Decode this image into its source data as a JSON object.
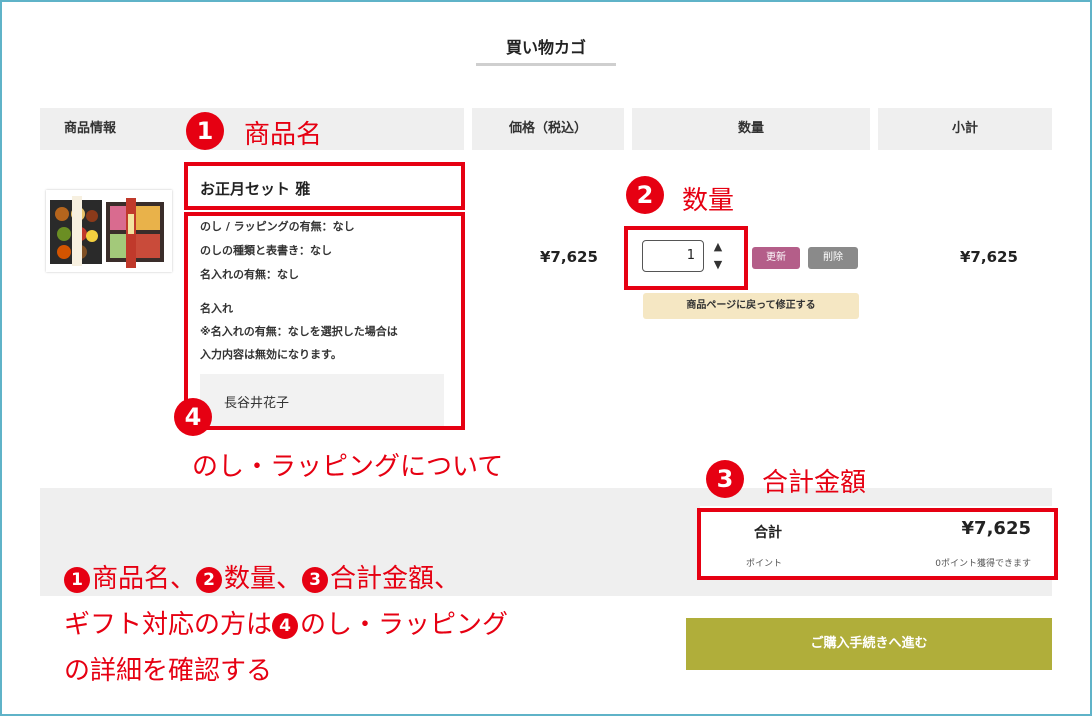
{
  "header": {
    "title": "買い物カゴ"
  },
  "table_headers": [
    "商品情報",
    "価格（税込）",
    "数量",
    "小計"
  ],
  "item": {
    "name": "お正月セット 雅",
    "options": [
      "のし / ラッピングの有無：なし",
      "のしの種類と表書き：なし",
      "名入れの有無：なし",
      "名入れ",
      "※名入れの有無：なしを選択した場合は",
      "入力内容は無効になります。"
    ],
    "engraving_name": "長谷井花子",
    "price": "¥7,625",
    "quantity": "1",
    "update_label": "更新",
    "delete_label": "削除",
    "return_label": "商品ページに戻って修正する",
    "subtotal": "¥7,625"
  },
  "summary": {
    "total_label": "合計",
    "total_amount": "¥7,625",
    "point_label": "ポイント",
    "point_note": "0ポイント獲得できます"
  },
  "checkout_label": "ご購入手続きへ進む",
  "annotations": {
    "numbers": [
      "1",
      "2",
      "3",
      "4"
    ],
    "labels": [
      "商品名",
      "数量",
      "合計金額",
      "のし・ラッピングについて"
    ],
    "highlight_color": "#e60012",
    "note": {
      "line1": [
        "商品名、",
        "数量、",
        "合計金額、"
      ],
      "line2_prefix": "ギフト対応の方は",
      "line2_suffix": "のし・ラッピング",
      "line3": "の詳細を確認する"
    }
  },
  "colors": {
    "update_button": "#b45e89",
    "delete_button": "#8a8a8a",
    "return_button": "#f5e7c3",
    "checkout_button": "#b0ae3a",
    "frame": "#5fb3c8"
  }
}
